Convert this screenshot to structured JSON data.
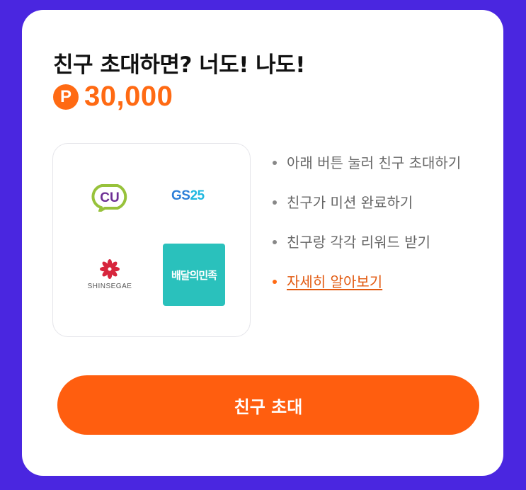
{
  "invite": {
    "title": "친구 초대하면? 너도! 나도!",
    "point_symbol": "P",
    "amount": "30,000"
  },
  "partners": {
    "cu": "CU",
    "gs25_prefix": "GS",
    "gs25_number": "25",
    "shinsegae": "SHINSEGAE",
    "baemin": "배달의민족"
  },
  "steps": [
    "아래 버튼 눌러 친구 초대하기",
    "친구가 미션 완료하기",
    "친구랑 각각 리워드 받기"
  ],
  "learn_more": "자세히 알아보기",
  "cta": {
    "label": "친구 초대"
  },
  "colors": {
    "background": "#4a26e0",
    "accent": "#ff5e0f",
    "cu_purple": "#6d2f95",
    "cu_green": "#97c23b",
    "baemin_mint": "#2ac1bc"
  }
}
